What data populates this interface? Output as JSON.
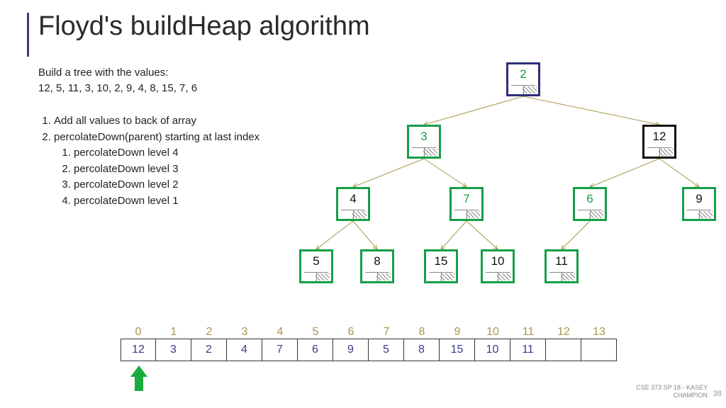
{
  "title": "Floyd's buildHeap algorithm",
  "intro_line1": "Build a tree with the values:",
  "intro_line2": "12, 5, 11, 3, 10, 2, 9, 4, 8, 15, 7, 6",
  "steps": {
    "s1": "Add all values to back of array",
    "s2": "percolateDown(parent) starting at last index",
    "s2_1": "percolateDown level 4",
    "s2_2": "percolateDown level 3",
    "s2_3": "percolateDown level 2",
    "s2_4": "percolateDown level 1"
  },
  "tree": {
    "n0": {
      "v": "2",
      "style": "navy"
    },
    "n1": {
      "v": "3",
      "style": "green"
    },
    "n2": {
      "v": "12",
      "style": "black"
    },
    "n3": {
      "v": "4",
      "style": "greenborder-black"
    },
    "n4": {
      "v": "7",
      "style": "green"
    },
    "n5": {
      "v": "6",
      "style": "green"
    },
    "n6": {
      "v": "9",
      "style": "greenborder-black"
    },
    "n7": {
      "v": "5",
      "style": "greenborder-black"
    },
    "n8": {
      "v": "8",
      "style": "greenborder-black"
    },
    "n9": {
      "v": "15",
      "style": "greenborder-black"
    },
    "n10": {
      "v": "10",
      "style": "greenborder-black"
    },
    "n11": {
      "v": "11",
      "style": "greenborder-black"
    }
  },
  "array": {
    "indices": [
      "0",
      "1",
      "2",
      "3",
      "4",
      "5",
      "6",
      "7",
      "8",
      "9",
      "10",
      "11",
      "12",
      "13"
    ],
    "values": [
      "12",
      "3",
      "2",
      "4",
      "7",
      "6",
      "9",
      "5",
      "8",
      "15",
      "10",
      "11",
      "",
      ""
    ]
  },
  "footer_line1": "CSE 373 SP 18 - KASEY",
  "footer_line2": "CHAMPION",
  "page": "38"
}
